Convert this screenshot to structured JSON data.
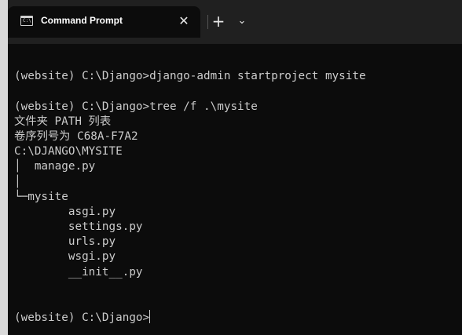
{
  "window": {
    "tab_title": "Command Prompt",
    "tab_icon_text": "C:\\",
    "close_label": "✕",
    "new_tab_label": "+",
    "dropdown_label": "⌄"
  },
  "terminal": {
    "lines": [
      "",
      "(website) C:\\Django>django-admin startproject mysite",
      "",
      "(website) C:\\Django>tree /f .\\mysite",
      "文件夹 PATH 列表",
      "卷序列号为 C68A-F7A2",
      "C:\\DJANGO\\MYSITE",
      "│  manage.py",
      "│",
      "└─mysite",
      "        asgi.py",
      "        settings.py",
      "        urls.py",
      "        wsgi.py",
      "        __init__.py",
      "",
      "",
      "(website) C:\\Django>"
    ]
  }
}
